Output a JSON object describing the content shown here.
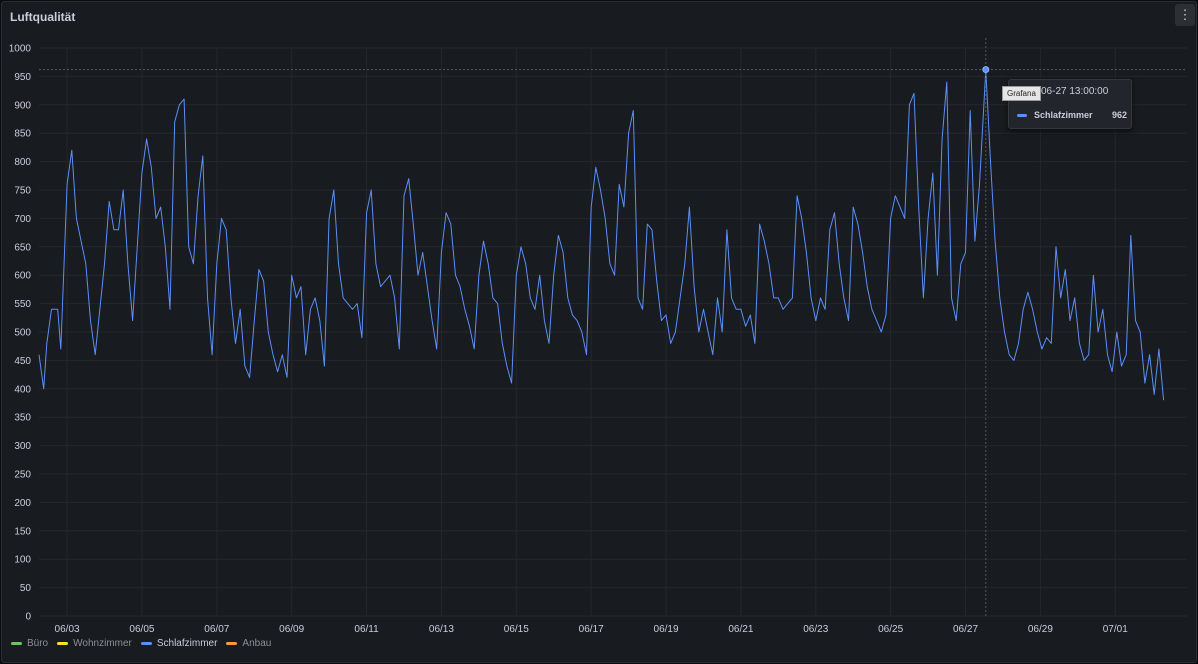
{
  "panel": {
    "title": "Luftqualität",
    "menu_icon": "⋮"
  },
  "legend": [
    {
      "label": "Büro",
      "color": "#73bf69",
      "active": false
    },
    {
      "label": "Wohnzimmer",
      "color": "#fade2a",
      "active": false
    },
    {
      "label": "Schlafzimmer",
      "color": "#5b8ff9",
      "active": true
    },
    {
      "label": "Anbau",
      "color": "#ff9830",
      "active": false
    }
  ],
  "tooltip": {
    "time": "06-27 13:00:00",
    "series": "Schlafzimmer",
    "value": "962",
    "badge": "Grafana"
  },
  "chart_data": {
    "type": "line",
    "title": "Luftqualität",
    "xlabel": "",
    "ylabel": "",
    "ylim": [
      0,
      1000
    ],
    "y_ticks": [
      0,
      50,
      100,
      150,
      200,
      250,
      300,
      350,
      400,
      450,
      500,
      550,
      600,
      650,
      700,
      750,
      800,
      850,
      900,
      950,
      1000
    ],
    "x_range": [
      "06-02 06:00",
      "07-02 22:00"
    ],
    "x_ticks": [
      "06/03",
      "06/05",
      "06/07",
      "06/09",
      "06/11",
      "06/13",
      "06/15",
      "06/17",
      "06/19",
      "06/21",
      "06/23",
      "06/25",
      "06/27",
      "06/29",
      "07/01"
    ],
    "grid": true,
    "legend_position": "bottom-left",
    "series": [
      {
        "name": "Schlafzimmer",
        "color": "#5b8ff9",
        "points": [
          [
            "06-02 06:00",
            460
          ],
          [
            "06-02 09:00",
            400
          ],
          [
            "06-02 11:00",
            480
          ],
          [
            "06-02 14:00",
            540
          ],
          [
            "06-02 18:00",
            540
          ],
          [
            "06-02 20:00",
            470
          ],
          [
            "06-03 00:00",
            760
          ],
          [
            "06-03 03:00",
            820
          ],
          [
            "06-03 06:00",
            700
          ],
          [
            "06-03 09:00",
            660
          ],
          [
            "06-03 12:00",
            620
          ],
          [
            "06-03 15:00",
            520
          ],
          [
            "06-03 18:00",
            460
          ],
          [
            "06-04 00:00",
            620
          ],
          [
            "06-04 03:00",
            730
          ],
          [
            "06-04 06:00",
            680
          ],
          [
            "06-04 09:00",
            680
          ],
          [
            "06-04 12:00",
            750
          ],
          [
            "06-04 15:00",
            620
          ],
          [
            "06-04 18:00",
            520
          ],
          [
            "06-05 00:00",
            780
          ],
          [
            "06-05 03:00",
            840
          ],
          [
            "06-05 06:00",
            790
          ],
          [
            "06-05 09:00",
            700
          ],
          [
            "06-05 12:00",
            720
          ],
          [
            "06-05 15:00",
            650
          ],
          [
            "06-05 18:00",
            540
          ],
          [
            "06-05 21:00",
            870
          ],
          [
            "06-06 00:00",
            900
          ],
          [
            "06-06 03:00",
            910
          ],
          [
            "06-06 06:00",
            650
          ],
          [
            "06-06 09:00",
            620
          ],
          [
            "06-06 12:00",
            740
          ],
          [
            "06-06 15:00",
            810
          ],
          [
            "06-06 18:00",
            560
          ],
          [
            "06-06 21:00",
            460
          ],
          [
            "06-07 00:00",
            620
          ],
          [
            "06-07 03:00",
            700
          ],
          [
            "06-07 06:00",
            680
          ],
          [
            "06-07 09:00",
            560
          ],
          [
            "06-07 12:00",
            480
          ],
          [
            "06-07 15:00",
            540
          ],
          [
            "06-07 18:00",
            440
          ],
          [
            "06-07 21:00",
            420
          ],
          [
            "06-08 00:00",
            520
          ],
          [
            "06-08 03:00",
            610
          ],
          [
            "06-08 06:00",
            590
          ],
          [
            "06-08 09:00",
            500
          ],
          [
            "06-08 12:00",
            460
          ],
          [
            "06-08 15:00",
            430
          ],
          [
            "06-08 18:00",
            460
          ],
          [
            "06-08 21:00",
            420
          ],
          [
            "06-09 00:00",
            600
          ],
          [
            "06-09 03:00",
            560
          ],
          [
            "06-09 06:00",
            580
          ],
          [
            "06-09 09:00",
            460
          ],
          [
            "06-09 12:00",
            540
          ],
          [
            "06-09 15:00",
            560
          ],
          [
            "06-09 18:00",
            520
          ],
          [
            "06-09 21:00",
            440
          ],
          [
            "06-10 00:00",
            700
          ],
          [
            "06-10 03:00",
            750
          ],
          [
            "06-10 06:00",
            620
          ],
          [
            "06-10 09:00",
            560
          ],
          [
            "06-10 12:00",
            550
          ],
          [
            "06-10 15:00",
            540
          ],
          [
            "06-10 18:00",
            550
          ],
          [
            "06-10 21:00",
            490
          ],
          [
            "06-11 00:00",
            710
          ],
          [
            "06-11 03:00",
            750
          ],
          [
            "06-11 06:00",
            620
          ],
          [
            "06-11 09:00",
            580
          ],
          [
            "06-11 12:00",
            590
          ],
          [
            "06-11 15:00",
            600
          ],
          [
            "06-11 18:00",
            560
          ],
          [
            "06-11 21:00",
            470
          ],
          [
            "06-12 00:00",
            740
          ],
          [
            "06-12 03:00",
            770
          ],
          [
            "06-12 06:00",
            690
          ],
          [
            "06-12 09:00",
            600
          ],
          [
            "06-12 12:00",
            640
          ],
          [
            "06-12 15:00",
            580
          ],
          [
            "06-12 18:00",
            520
          ],
          [
            "06-12 21:00",
            470
          ],
          [
            "06-13 00:00",
            640
          ],
          [
            "06-13 03:00",
            710
          ],
          [
            "06-13 06:00",
            690
          ],
          [
            "06-13 09:00",
            600
          ],
          [
            "06-13 12:00",
            580
          ],
          [
            "06-13 15:00",
            540
          ],
          [
            "06-13 18:00",
            510
          ],
          [
            "06-13 21:00",
            470
          ],
          [
            "06-14 00:00",
            600
          ],
          [
            "06-14 03:00",
            660
          ],
          [
            "06-14 06:00",
            620
          ],
          [
            "06-14 09:00",
            560
          ],
          [
            "06-14 12:00",
            550
          ],
          [
            "06-14 15:00",
            480
          ],
          [
            "06-14 18:00",
            440
          ],
          [
            "06-14 21:00",
            410
          ],
          [
            "06-15 00:00",
            600
          ],
          [
            "06-15 03:00",
            650
          ],
          [
            "06-15 06:00",
            620
          ],
          [
            "06-15 09:00",
            560
          ],
          [
            "06-15 12:00",
            540
          ],
          [
            "06-15 15:00",
            600
          ],
          [
            "06-15 18:00",
            520
          ],
          [
            "06-15 21:00",
            480
          ],
          [
            "06-16 00:00",
            600
          ],
          [
            "06-16 03:00",
            670
          ],
          [
            "06-16 06:00",
            640
          ],
          [
            "06-16 09:00",
            560
          ],
          [
            "06-16 12:00",
            530
          ],
          [
            "06-16 15:00",
            520
          ],
          [
            "06-16 18:00",
            500
          ],
          [
            "06-16 21:00",
            460
          ],
          [
            "06-17 00:00",
            720
          ],
          [
            "06-17 03:00",
            790
          ],
          [
            "06-17 06:00",
            750
          ],
          [
            "06-17 09:00",
            700
          ],
          [
            "06-17 12:00",
            620
          ],
          [
            "06-17 15:00",
            600
          ],
          [
            "06-17 18:00",
            760
          ],
          [
            "06-17 21:00",
            720
          ],
          [
            "06-18 00:00",
            850
          ],
          [
            "06-18 03:00",
            890
          ],
          [
            "06-18 06:00",
            560
          ],
          [
            "06-18 09:00",
            540
          ],
          [
            "06-18 12:00",
            690
          ],
          [
            "06-18 15:00",
            680
          ],
          [
            "06-18 18:00",
            590
          ],
          [
            "06-18 21:00",
            520
          ],
          [
            "06-19 00:00",
            530
          ],
          [
            "06-19 03:00",
            480
          ],
          [
            "06-19 06:00",
            500
          ],
          [
            "06-19 09:00",
            560
          ],
          [
            "06-19 12:00",
            620
          ],
          [
            "06-19 15:00",
            720
          ],
          [
            "06-19 18:00",
            580
          ],
          [
            "06-19 21:00",
            500
          ],
          [
            "06-20 00:00",
            540
          ],
          [
            "06-20 03:00",
            500
          ],
          [
            "06-20 06:00",
            460
          ],
          [
            "06-20 09:00",
            560
          ],
          [
            "06-20 12:00",
            500
          ],
          [
            "06-20 15:00",
            680
          ],
          [
            "06-20 18:00",
            560
          ],
          [
            "06-20 21:00",
            540
          ],
          [
            "06-21 00:00",
            540
          ],
          [
            "06-21 03:00",
            510
          ],
          [
            "06-21 06:00",
            530
          ],
          [
            "06-21 09:00",
            480
          ],
          [
            "06-21 12:00",
            690
          ],
          [
            "06-21 15:00",
            660
          ],
          [
            "06-21 18:00",
            620
          ],
          [
            "06-21 21:00",
            560
          ],
          [
            "06-22 00:00",
            560
          ],
          [
            "06-22 03:00",
            540
          ],
          [
            "06-22 06:00",
            550
          ],
          [
            "06-22 09:00",
            560
          ],
          [
            "06-22 12:00",
            740
          ],
          [
            "06-22 15:00",
            700
          ],
          [
            "06-22 18:00",
            640
          ],
          [
            "06-22 21:00",
            560
          ],
          [
            "06-23 00:00",
            520
          ],
          [
            "06-23 03:00",
            560
          ],
          [
            "06-23 06:00",
            540
          ],
          [
            "06-23 09:00",
            680
          ],
          [
            "06-23 12:00",
            710
          ],
          [
            "06-23 15:00",
            620
          ],
          [
            "06-23 18:00",
            560
          ],
          [
            "06-23 21:00",
            520
          ],
          [
            "06-24 00:00",
            720
          ],
          [
            "06-24 03:00",
            690
          ],
          [
            "06-24 06:00",
            640
          ],
          [
            "06-24 09:00",
            580
          ],
          [
            "06-24 12:00",
            540
          ],
          [
            "06-24 15:00",
            520
          ],
          [
            "06-24 18:00",
            500
          ],
          [
            "06-24 21:00",
            530
          ],
          [
            "06-25 00:00",
            700
          ],
          [
            "06-25 03:00",
            740
          ],
          [
            "06-25 06:00",
            720
          ],
          [
            "06-25 09:00",
            700
          ],
          [
            "06-25 12:00",
            900
          ],
          [
            "06-25 15:00",
            920
          ],
          [
            "06-25 18:00",
            720
          ],
          [
            "06-25 21:00",
            560
          ],
          [
            "06-26 00:00",
            700
          ],
          [
            "06-26 03:00",
            780
          ],
          [
            "06-26 06:00",
            600
          ],
          [
            "06-26 09:00",
            840
          ],
          [
            "06-26 12:00",
            940
          ],
          [
            "06-26 15:00",
            560
          ],
          [
            "06-26 18:00",
            520
          ],
          [
            "06-26 21:00",
            620
          ],
          [
            "06-27 00:00",
            640
          ],
          [
            "06-27 03:00",
            890
          ],
          [
            "06-27 06:00",
            660
          ],
          [
            "06-27 09:00",
            760
          ],
          [
            "06-27 13:00",
            962
          ],
          [
            "06-27 16:00",
            800
          ],
          [
            "06-27 19:00",
            660
          ],
          [
            "06-27 22:00",
            560
          ],
          [
            "06-28 01:00",
            500
          ],
          [
            "06-28 04:00",
            460
          ],
          [
            "06-28 07:00",
            450
          ],
          [
            "06-28 10:00",
            480
          ],
          [
            "06-28 13:00",
            540
          ],
          [
            "06-28 16:00",
            570
          ],
          [
            "06-28 19:00",
            540
          ],
          [
            "06-28 22:00",
            500
          ],
          [
            "06-29 01:00",
            470
          ],
          [
            "06-29 04:00",
            490
          ],
          [
            "06-29 07:00",
            480
          ],
          [
            "06-29 10:00",
            650
          ],
          [
            "06-29 13:00",
            560
          ],
          [
            "06-29 16:00",
            610
          ],
          [
            "06-29 19:00",
            520
          ],
          [
            "06-29 22:00",
            560
          ],
          [
            "06-30 01:00",
            480
          ],
          [
            "06-30 04:00",
            450
          ],
          [
            "06-30 07:00",
            460
          ],
          [
            "06-30 10:00",
            600
          ],
          [
            "06-30 13:00",
            500
          ],
          [
            "06-30 16:00",
            540
          ],
          [
            "06-30 19:00",
            460
          ],
          [
            "06-30 22:00",
            430
          ],
          [
            "07-01 01:00",
            500
          ],
          [
            "07-01 04:00",
            440
          ],
          [
            "07-01 07:00",
            460
          ],
          [
            "07-01 10:00",
            670
          ],
          [
            "07-01 13:00",
            520
          ],
          [
            "07-01 16:00",
            500
          ],
          [
            "07-01 19:00",
            410
          ],
          [
            "07-01 22:00",
            460
          ],
          [
            "07-02 01:00",
            390
          ],
          [
            "07-02 04:00",
            470
          ],
          [
            "07-02 07:00",
            380
          ]
        ]
      }
    ],
    "hover": {
      "x": "06-27 13:00",
      "y": 962,
      "series": "Schlafzimmer"
    }
  }
}
